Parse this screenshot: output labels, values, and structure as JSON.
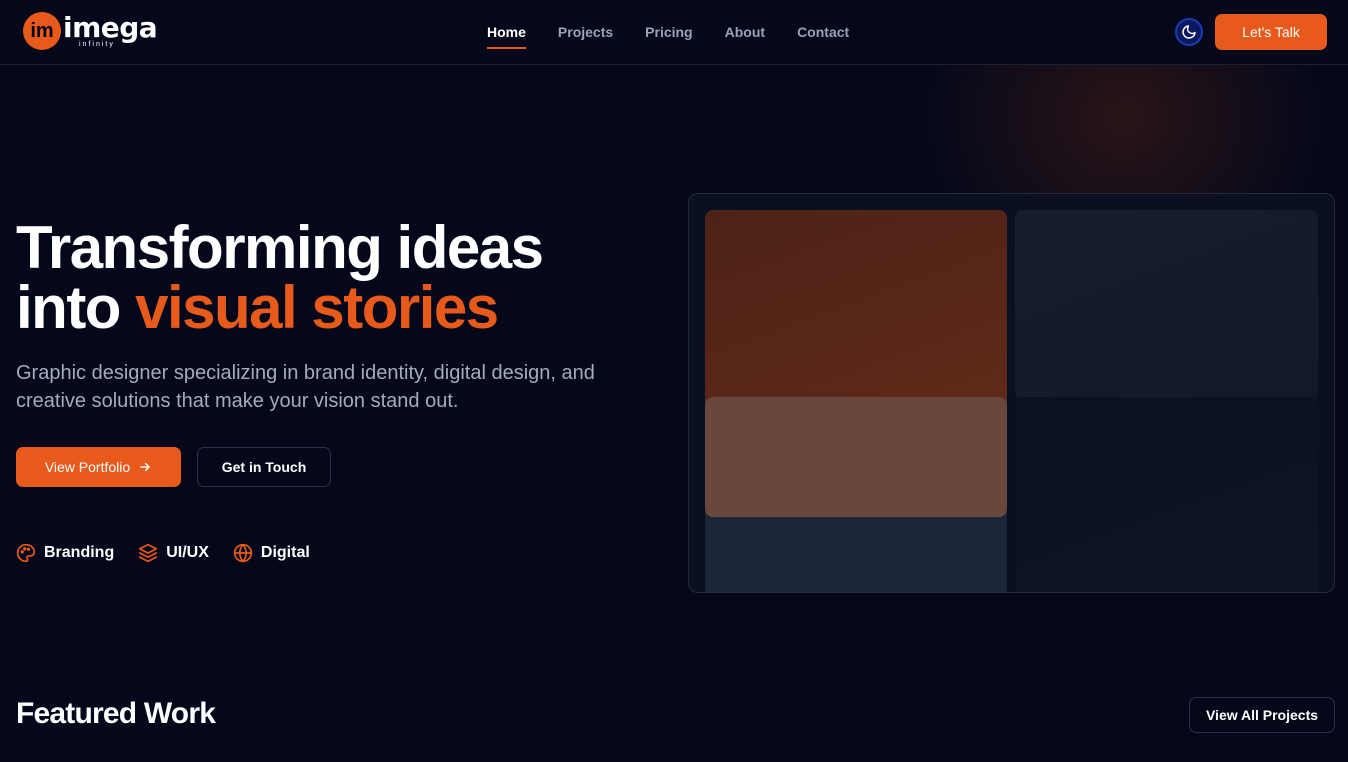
{
  "brand": {
    "logo_mark": "im",
    "logo_word": "imega",
    "logo_sub": "infinity"
  },
  "nav": {
    "items": [
      {
        "label": "Home",
        "active": true
      },
      {
        "label": "Projects",
        "active": false
      },
      {
        "label": "Pricing",
        "active": false
      },
      {
        "label": "About",
        "active": false
      },
      {
        "label": "Contact",
        "active": false
      }
    ]
  },
  "header": {
    "theme_icon": "moon-icon",
    "cta_label": "Let's Talk"
  },
  "hero": {
    "title_line1": "Transforming ideas",
    "title_line2_plain": "into ",
    "title_line2_accent": "visual stories",
    "subtitle": "Graphic designer specializing in brand identity, digital design, and creative solutions that make your vision stand out.",
    "primary_button": "View Portfolio",
    "secondary_button": "Get in Touch",
    "tags": [
      {
        "label": "Branding",
        "icon": "palette-icon"
      },
      {
        "label": "UI/UX",
        "icon": "layers-icon"
      },
      {
        "label": "Digital",
        "icon": "globe-icon"
      }
    ]
  },
  "featured": {
    "title": "Featured Work",
    "view_all": "View All Projects"
  },
  "colors": {
    "accent": "#e85a1c",
    "background": "#05081a",
    "muted_text": "#a3abbd"
  }
}
